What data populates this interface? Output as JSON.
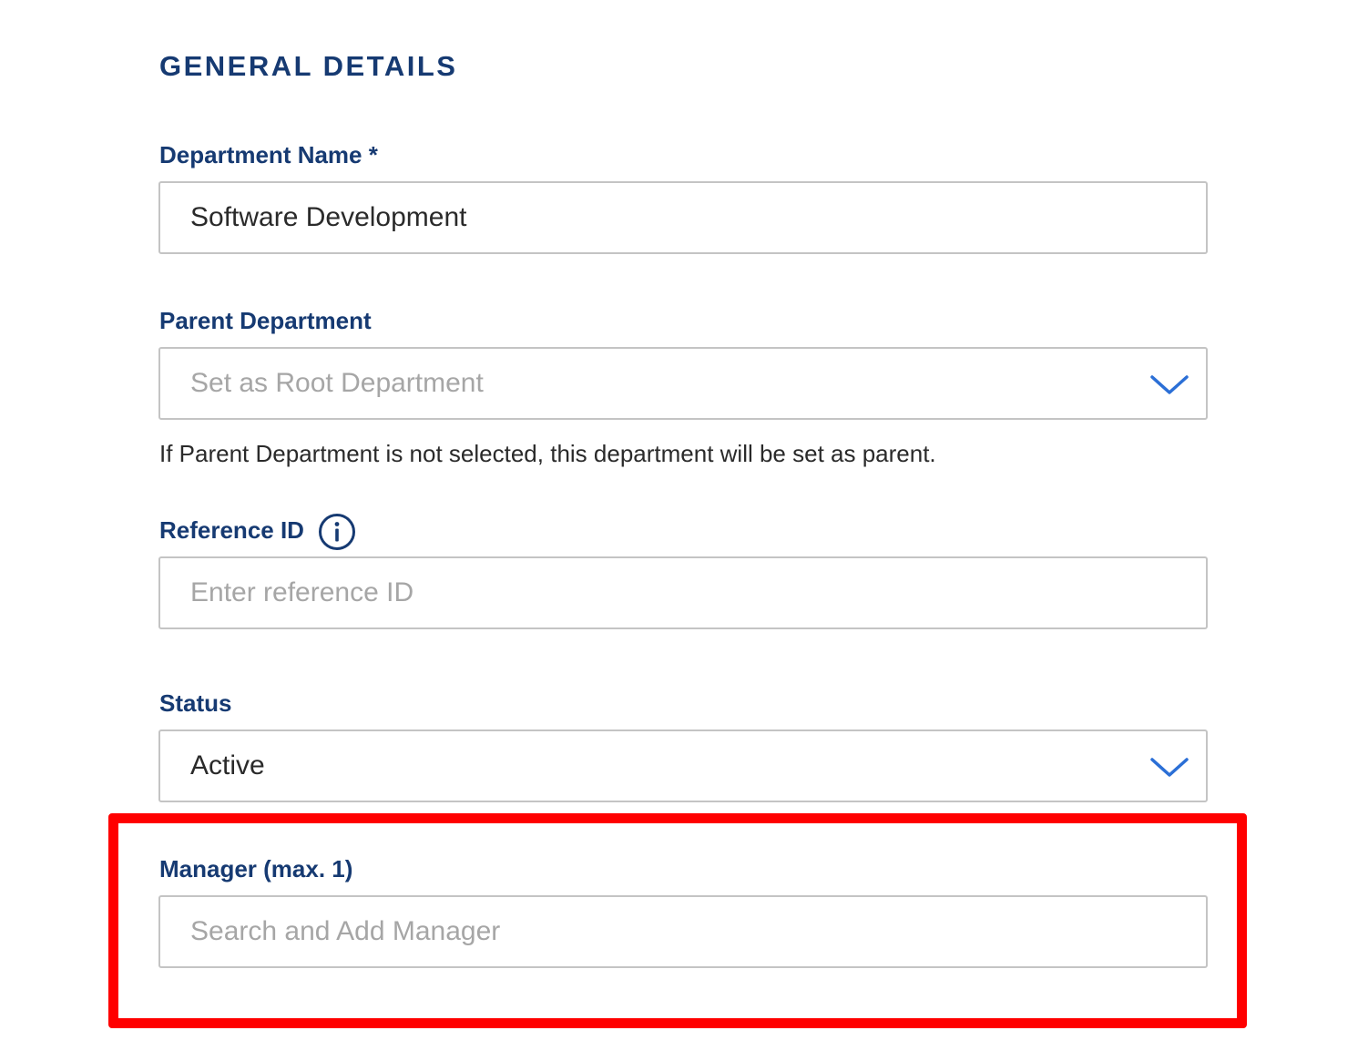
{
  "section": {
    "title": "GENERAL DETAILS"
  },
  "department_name": {
    "label": "Department Name *",
    "value": "Software Development"
  },
  "parent_department": {
    "label": "Parent Department",
    "placeholder": "Set as Root Department",
    "help_text": "If Parent Department is not selected, this department will be set as parent.",
    "icon": "chevron-down-icon"
  },
  "reference_id": {
    "label": "Reference ID",
    "placeholder": "Enter reference ID",
    "icon": "info-icon"
  },
  "status": {
    "label": "Status",
    "value": "Active",
    "icon": "chevron-down-icon"
  },
  "manager": {
    "label": "Manager (max. 1)",
    "placeholder": "Search and Add Manager"
  },
  "colors": {
    "label": "#163a72",
    "accent": "#2b6fd6",
    "highlight": "#ff0000",
    "border": "#c4c4c4",
    "placeholder": "#a6a6a6"
  }
}
